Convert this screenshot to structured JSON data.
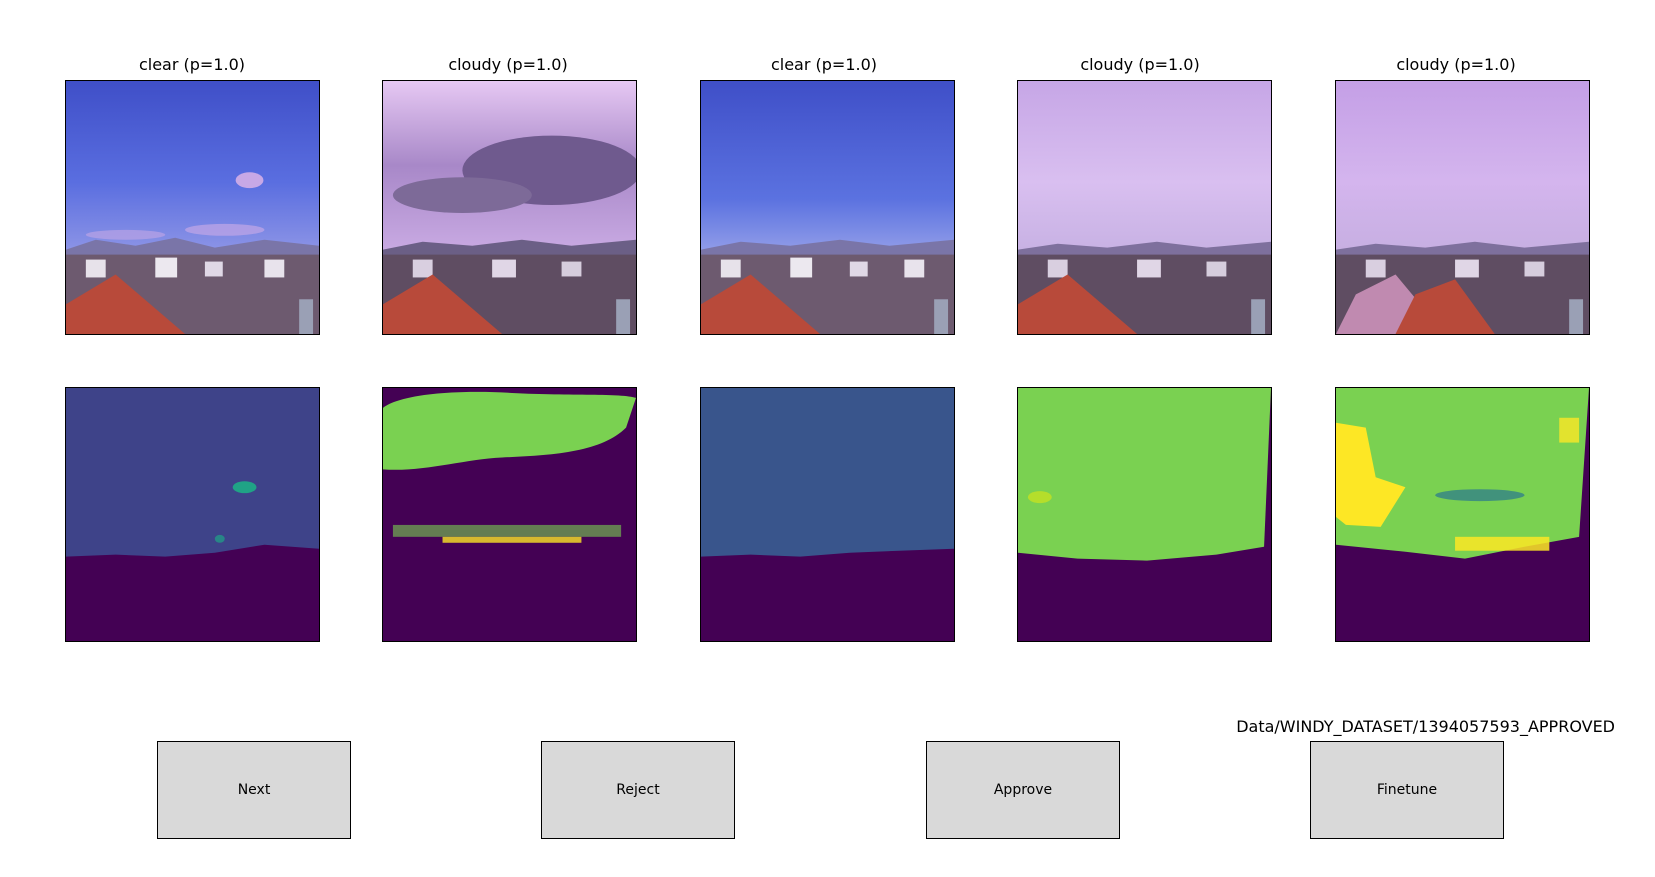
{
  "panels": [
    {
      "title": "clear (p=1.0)",
      "sky": "clear",
      "mask_color": "#3e4389"
    },
    {
      "title": "cloudy (p=1.0)",
      "sky": "cloudy-dark",
      "mask_color": "#7ad151"
    },
    {
      "title": "clear (p=1.0)",
      "sky": "clear",
      "mask_color": "#39558c"
    },
    {
      "title": "cloudy (p=1.0)",
      "sky": "overcast",
      "mask_color": "#7ad151"
    },
    {
      "title": "cloudy (p=1.0)",
      "sky": "overcast",
      "mask_color": "#7ad151"
    }
  ],
  "colors": {
    "mask_background": "#440154",
    "mask_yellow": "#fde725",
    "mask_teal": "#20a386",
    "roof": "#b84a3a",
    "button_bg": "#d9d9d9"
  },
  "file_path": "Data/WINDY_DATASET/1394057593_APPROVED",
  "buttons": {
    "next": "Next",
    "reject": "Reject",
    "approve": "Approve",
    "finetune": "Finetune"
  }
}
